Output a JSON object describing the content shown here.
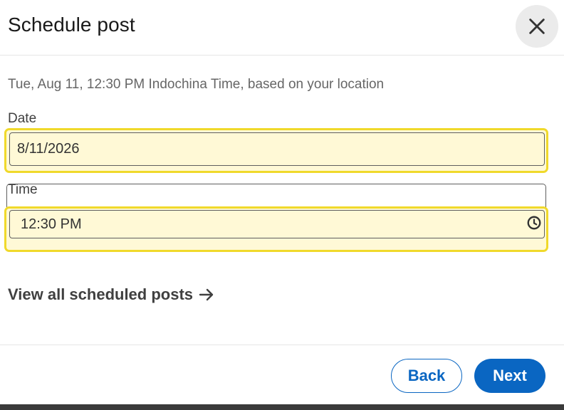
{
  "dialog": {
    "title": "Schedule post",
    "close_icon": "close-icon"
  },
  "info": {
    "timezone_text": "Tue, Aug 11, 12:30 PM Indochina Time, based on your location"
  },
  "date_field": {
    "label": "Date",
    "value": "8/11/2026"
  },
  "time_field": {
    "label": "Time",
    "value": "12:30 PM",
    "icon": "clock-icon"
  },
  "link": {
    "label": "View all scheduled posts",
    "icon": "arrow-right-icon"
  },
  "footer": {
    "back_label": "Back",
    "next_label": "Next"
  },
  "colors": {
    "primary": "#0a66c2",
    "highlight_border": "#f0d92b",
    "highlight_fill": "#fff9d6"
  }
}
